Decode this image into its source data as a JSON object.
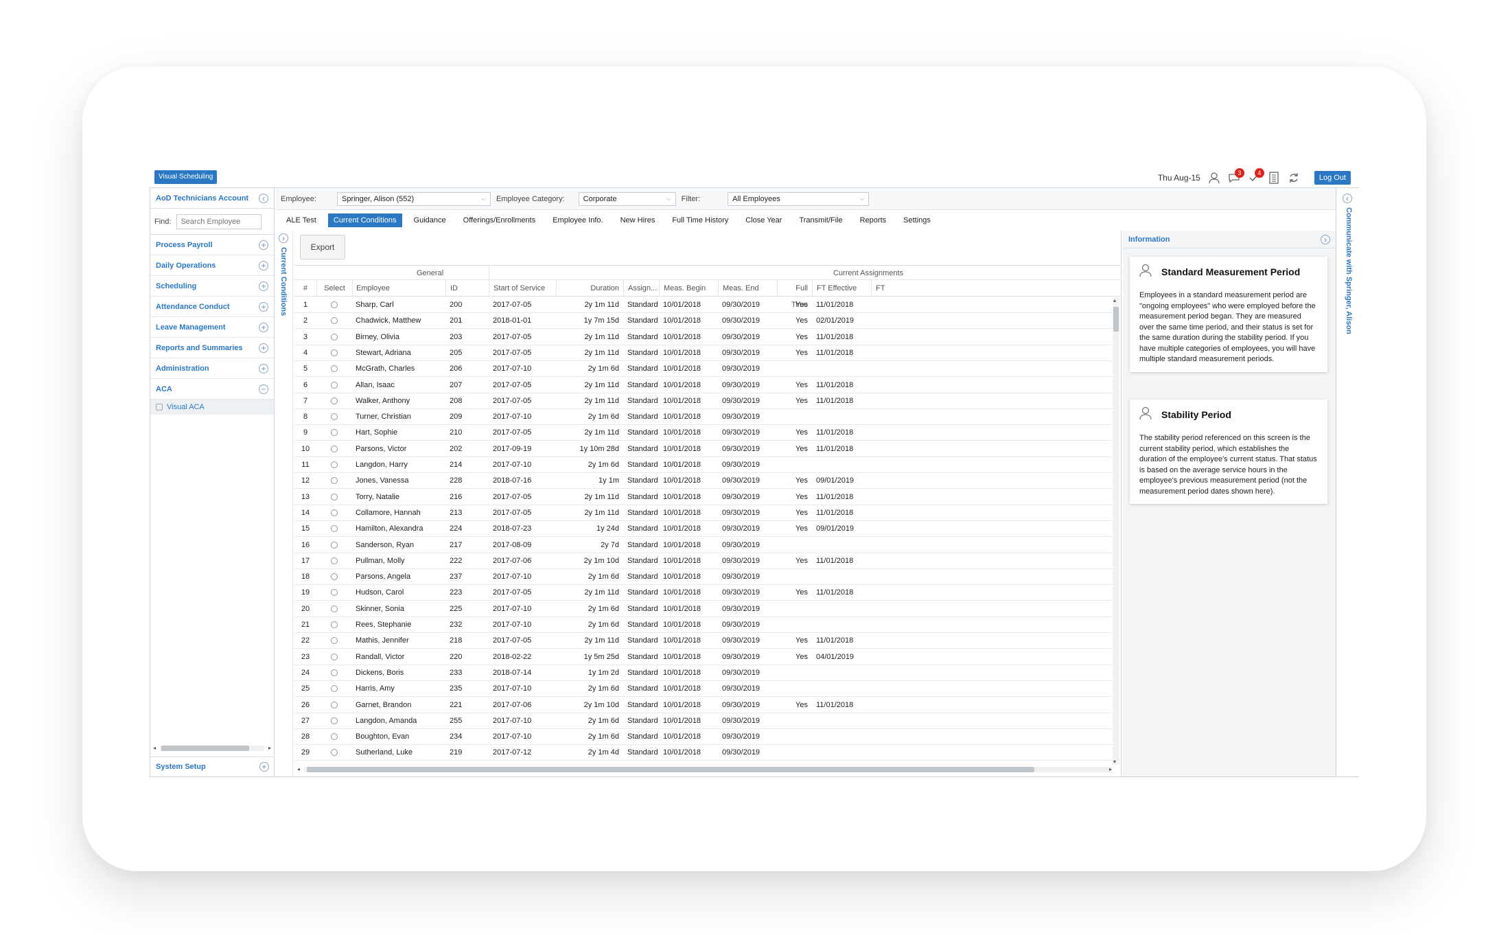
{
  "topbar": {
    "visual_scheduling": "Visual Scheduling",
    "date": "Thu Aug-15",
    "messages_count": "3",
    "alerts_count": "4",
    "logout": "Log Out"
  },
  "sidebar": {
    "account": "AoD Technicians Account",
    "find_label": "Find:",
    "search_placeholder": "Search Employee",
    "items": [
      {
        "label": "Process Payroll",
        "state": "+"
      },
      {
        "label": "Daily Operations",
        "state": "+"
      },
      {
        "label": "Scheduling",
        "state": "+"
      },
      {
        "label": "Attendance Conduct",
        "state": "+"
      },
      {
        "label": "Leave Management",
        "state": "+"
      },
      {
        "label": "Reports and Summaries",
        "state": "+"
      },
      {
        "label": "Administration",
        "state": "+"
      },
      {
        "label": "ACA",
        "state": "−"
      }
    ],
    "sub_item": "Visual ACA",
    "system_setup": "System Setup"
  },
  "filters": {
    "employee_label": "Employee:",
    "employee_value": "Springer, Alison  (552)",
    "category_label": "Employee Category:",
    "category_value": "Corporate",
    "filter_label": "Filter:",
    "filter_value": "All Employees"
  },
  "tabs": [
    "ALE Test",
    "Current Conditions",
    "Guidance",
    "Offerings/Enrollments",
    "Employee Info.",
    "New Hires",
    "Full Time History",
    "Close Year",
    "Transmit/File",
    "Reports",
    "Settings"
  ],
  "active_tab": "Current Conditions",
  "left_vertical": "Current Conditions",
  "right_vertical": "Communicate with Springer, Alison",
  "grid": {
    "export": "Export",
    "group_general": "General",
    "group_current": "Current Assignments",
    "columns": [
      "#",
      "Select",
      "Employee",
      "ID",
      "Start of Service",
      "Duration",
      "Assign...",
      "Meas. Begin",
      "Meas. End",
      "Full Time",
      "FT Effective",
      "FT"
    ],
    "rows": [
      [
        "1",
        "Sharp, Carl",
        "200",
        "2017-07-05",
        "2y 1m 11d",
        "Standard",
        "10/01/2018",
        "09/30/2019",
        "Yes",
        "11/01/2018"
      ],
      [
        "2",
        "Chadwick, Matthew",
        "201",
        "2018-01-01",
        "1y 7m 15d",
        "Standard",
        "10/01/2018",
        "09/30/2019",
        "Yes",
        "02/01/2019"
      ],
      [
        "3",
        "Birney, Olivia",
        "203",
        "2017-07-05",
        "2y 1m 11d",
        "Standard",
        "10/01/2018",
        "09/30/2019",
        "Yes",
        "11/01/2018"
      ],
      [
        "4",
        "Stewart, Adriana",
        "205",
        "2017-07-05",
        "2y 1m 11d",
        "Standard",
        "10/01/2018",
        "09/30/2019",
        "Yes",
        "11/01/2018"
      ],
      [
        "5",
        "McGrath, Charles",
        "206",
        "2017-07-10",
        "2y 1m 6d",
        "Standard",
        "10/01/2018",
        "09/30/2019",
        "",
        ""
      ],
      [
        "6",
        "Allan, Isaac",
        "207",
        "2017-07-05",
        "2y 1m 11d",
        "Standard",
        "10/01/2018",
        "09/30/2019",
        "Yes",
        "11/01/2018"
      ],
      [
        "7",
        "Walker, Anthony",
        "208",
        "2017-07-05",
        "2y 1m 11d",
        "Standard",
        "10/01/2018",
        "09/30/2019",
        "Yes",
        "11/01/2018"
      ],
      [
        "8",
        "Turner, Christian",
        "209",
        "2017-07-10",
        "2y 1m 6d",
        "Standard",
        "10/01/2018",
        "09/30/2019",
        "",
        ""
      ],
      [
        "9",
        "Hart, Sophie",
        "210",
        "2017-07-05",
        "2y 1m 11d",
        "Standard",
        "10/01/2018",
        "09/30/2019",
        "Yes",
        "11/01/2018"
      ],
      [
        "10",
        "Parsons, Victor",
        "202",
        "2017-09-19",
        "1y 10m 28d",
        "Standard",
        "10/01/2018",
        "09/30/2019",
        "Yes",
        "11/01/2018"
      ],
      [
        "11",
        "Langdon, Harry",
        "214",
        "2017-07-10",
        "2y 1m 6d",
        "Standard",
        "10/01/2018",
        "09/30/2019",
        "",
        ""
      ],
      [
        "12",
        "Jones, Vanessa",
        "228",
        "2018-07-16",
        "1y 1m",
        "Standard",
        "10/01/2018",
        "09/30/2019",
        "Yes",
        "09/01/2019"
      ],
      [
        "13",
        "Torry, Natalie",
        "216",
        "2017-07-05",
        "2y 1m 11d",
        "Standard",
        "10/01/2018",
        "09/30/2019",
        "Yes",
        "11/01/2018"
      ],
      [
        "14",
        "Collamore, Hannah",
        "213",
        "2017-07-05",
        "2y 1m 11d",
        "Standard",
        "10/01/2018",
        "09/30/2019",
        "Yes",
        "11/01/2018"
      ],
      [
        "15",
        "Hamilton, Alexandra",
        "224",
        "2018-07-23",
        "1y 24d",
        "Standard",
        "10/01/2018",
        "09/30/2019",
        "Yes",
        "09/01/2019"
      ],
      [
        "16",
        "Sanderson, Ryan",
        "217",
        "2017-08-09",
        "2y 7d",
        "Standard",
        "10/01/2018",
        "09/30/2019",
        "",
        ""
      ],
      [
        "17",
        "Pullman, Molly",
        "222",
        "2017-07-06",
        "2y 1m 10d",
        "Standard",
        "10/01/2018",
        "09/30/2019",
        "Yes",
        "11/01/2018"
      ],
      [
        "18",
        "Parsons, Angela",
        "237",
        "2017-07-10",
        "2y 1m 6d",
        "Standard",
        "10/01/2018",
        "09/30/2019",
        "",
        ""
      ],
      [
        "19",
        "Hudson, Carol",
        "223",
        "2017-07-05",
        "2y 1m 11d",
        "Standard",
        "10/01/2018",
        "09/30/2019",
        "Yes",
        "11/01/2018"
      ],
      [
        "20",
        "Skinner, Sonia",
        "225",
        "2017-07-10",
        "2y 1m 6d",
        "Standard",
        "10/01/2018",
        "09/30/2019",
        "",
        ""
      ],
      [
        "21",
        "Rees, Stephanie",
        "232",
        "2017-07-10",
        "2y 1m 6d",
        "Standard",
        "10/01/2018",
        "09/30/2019",
        "",
        ""
      ],
      [
        "22",
        "Mathis, Jennifer",
        "218",
        "2017-07-05",
        "2y 1m 11d",
        "Standard",
        "10/01/2018",
        "09/30/2019",
        "Yes",
        "11/01/2018"
      ],
      [
        "23",
        "Randall, Victor",
        "220",
        "2018-02-22",
        "1y 5m 25d",
        "Standard",
        "10/01/2018",
        "09/30/2019",
        "Yes",
        "04/01/2019"
      ],
      [
        "24",
        "Dickens, Boris",
        "233",
        "2018-07-14",
        "1y 1m 2d",
        "Standard",
        "10/01/2018",
        "09/30/2019",
        "",
        ""
      ],
      [
        "25",
        "Harris, Amy",
        "235",
        "2017-07-10",
        "2y 1m 6d",
        "Standard",
        "10/01/2018",
        "09/30/2019",
        "",
        ""
      ],
      [
        "26",
        "Garnet, Brandon",
        "221",
        "2017-07-06",
        "2y 1m 10d",
        "Standard",
        "10/01/2018",
        "09/30/2019",
        "Yes",
        "11/01/2018"
      ],
      [
        "27",
        "Langdon, Amanda",
        "255",
        "2017-07-10",
        "2y 1m 6d",
        "Standard",
        "10/01/2018",
        "09/30/2019",
        "",
        ""
      ],
      [
        "28",
        "Boughton, Evan",
        "234",
        "2017-07-10",
        "2y 1m 6d",
        "Standard",
        "10/01/2018",
        "09/30/2019",
        "",
        ""
      ],
      [
        "29",
        "Sutherland, Luke",
        "219",
        "2017-07-12",
        "2y 1m 4d",
        "Standard",
        "10/01/2018",
        "09/30/2019",
        "",
        ""
      ]
    ]
  },
  "info": {
    "header": "Information",
    "cards": [
      {
        "title": "Standard Measurement Period",
        "body": "Employees in a standard measurement period are \"ongoing employees\" who were employed before the measurement period began. They are measured over the same time period, and their status is set for the same duration during the stability period. If you have multiple categories of employees, you will have multiple standard measurement periods."
      },
      {
        "title": "Stability Period",
        "body": "The stability period referenced on this screen is the current stability period, which establishes the duration of the employee's current status. That status is based on the average service hours in the employee's previous measurement period (not the measurement period dates shown here)."
      }
    ]
  },
  "colors": {
    "accent": "#2b78c4",
    "badge": "#e0211b"
  }
}
